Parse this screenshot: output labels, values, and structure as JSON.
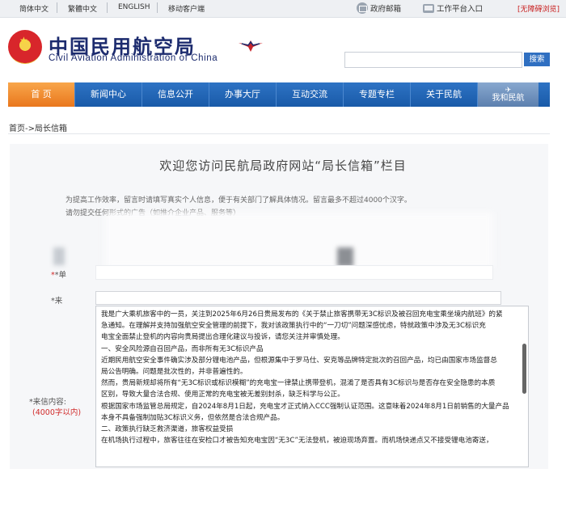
{
  "top_bar": {
    "langs": [
      "简体中文",
      "繁體中文",
      "ENGLISH",
      "移动客户端"
    ],
    "mail_label": "政府邮箱",
    "workbench_label": "工作平台入口",
    "accessibility_label": "[无障碍浏览]"
  },
  "header": {
    "title_cn": "中国民用航空局",
    "title_en": "Civil Aviation Administration of China",
    "search_button": "搜索"
  },
  "nav": {
    "items": [
      "首 页",
      "新闻中心",
      "信息公开",
      "办事大厅",
      "互动交流",
      "专题专栏",
      "关于民航"
    ],
    "last_item": "我和民航"
  },
  "breadcrumb": "首页->局长信箱",
  "page": {
    "title": "欢迎您访问民航局政府网站“局长信箱”栏目",
    "notice_lines": [
      "为提高工作效率，留言时请填写真实个人信息，便于有关部门了解具体情况。留言最多不超过4000个汉字。",
      "请勿提交任何形式的广告（如推介企业产品、服务等）"
    ]
  },
  "form": {
    "field1_label": "*单",
    "field2_label": "*来",
    "content_label": "*来信内容:",
    "content_limit": "(4000字以内)",
    "message_lines": [
      "我是广大乘机旅客中的一员，关注到2025年6月26日贵局发布的《关于禁止旅客携带无3C标识及被召回充电宝乘坐境内航班》的紧",
      "急通知。在理解并支持加强航空安全管理的前提下，我对该政策执行中的“一刀切”问题深感忧虑，特就政策中涉及无3C标识充",
      "电宝全面禁止登机的内容向贵局提出合理化建议与投诉，请您关注并审慎处理。",
      "一、安全风险源自召回产品，而非所有无3C标识产品",
      "近期民用航空安全事件确实涉及部分锂电池产品，但根源集中于罗马仕、安克等品牌特定批次的召回产品，均已由国家市场监督总",
      "局公告明确。问题是批次性的，并非普遍性的。",
      "然而，贵局新规却将所有“无3C标识或标识模糊”的充电宝一律禁止携带登机，混淆了是否具有3C标识与是否存在安全隐患的本质",
      "区别，导致大量合法合规、使用正常的充电宝被无差别封杀，缺乏科学与公正。",
      "根据国家市场监管总局规定，自2024年8月1日起，充电宝才正式纳入CCC强制认证范围。这意味着2024年8月1日前销售的大量产品",
      "本身不具备强制加贴3C标识义务，但依然是合法合规产品。",
      "二、政策执行缺乏救济渠道，旅客权益受损",
      "在机场执行过程中，旅客往往在安检口才被告知充电宝因“无3C”无法登机，被迫现场弃置。而机场快递点又不接受锂电池寄送，"
    ]
  }
}
